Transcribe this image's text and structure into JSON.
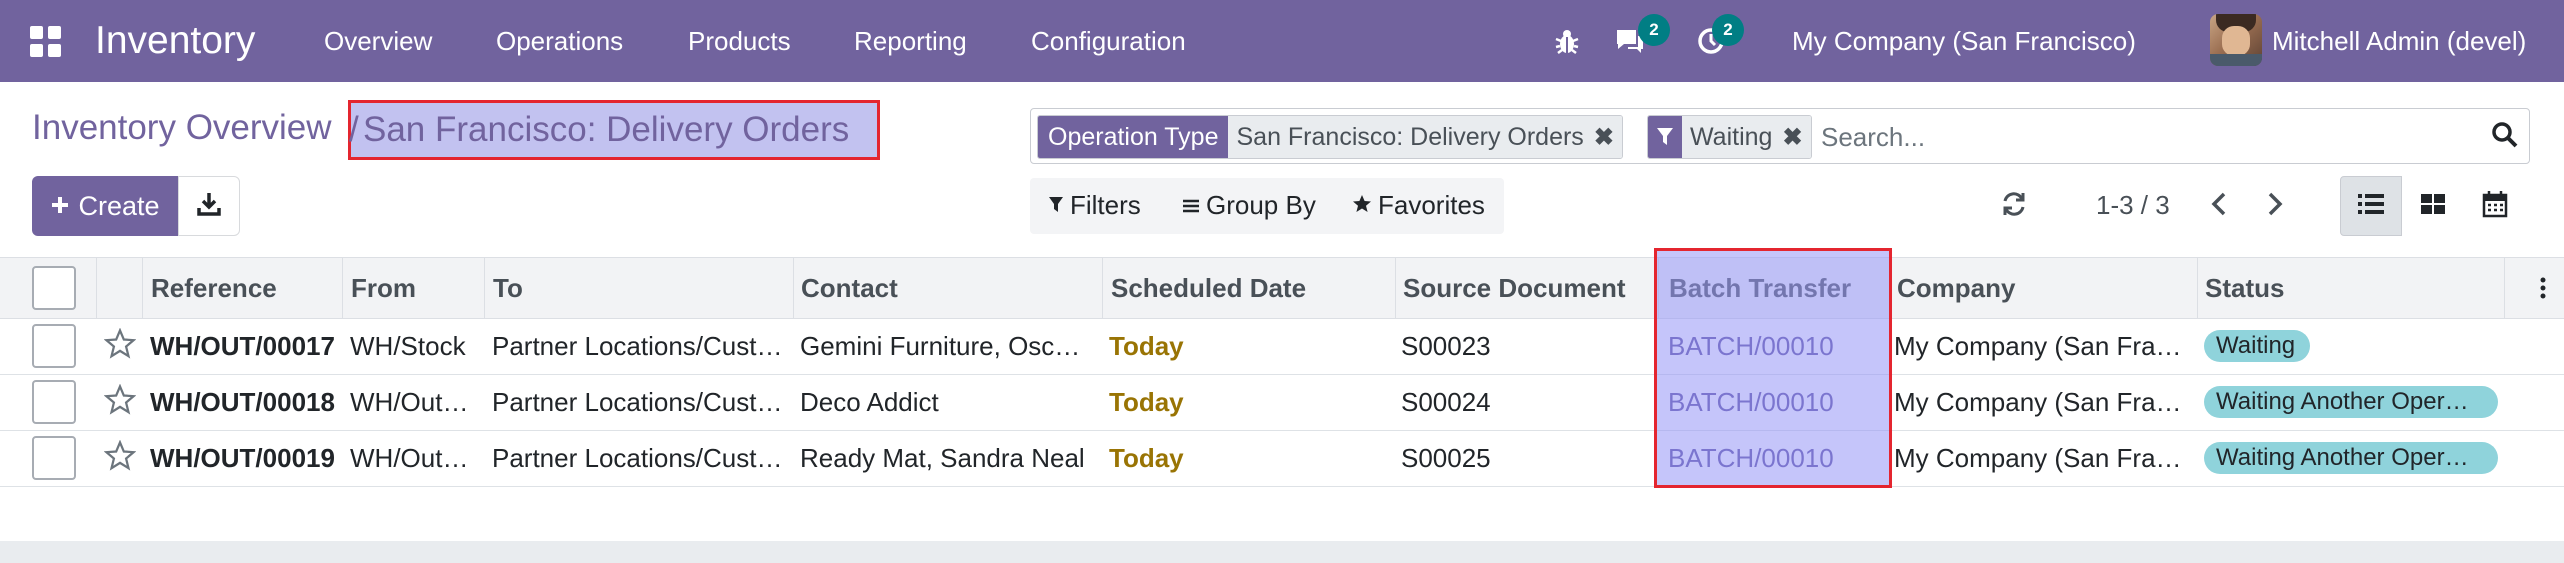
{
  "navbar": {
    "app_name": "Inventory",
    "menu": [
      "Overview",
      "Operations",
      "Products",
      "Reporting",
      "Configuration"
    ],
    "messages_count": "2",
    "activities_count": "2",
    "company": "My Company (San Francisco)",
    "user": "Mitchell Admin (devel)",
    "icons": [
      "apps-grid-icon",
      "bug-icon",
      "chat-icon",
      "clock-icon"
    ],
    "color": "#71639e"
  },
  "breadcrumb": {
    "parent": "Inventory Overview",
    "separator": "/",
    "current": "San Francisco: Delivery Orders"
  },
  "actions": {
    "create_label": "Create",
    "download_icon": "download-icon"
  },
  "search": {
    "facets": [
      {
        "label": "Operation Type",
        "value": "San Francisco: Delivery Orders"
      },
      {
        "label": "filter-icon",
        "value": "Waiting"
      }
    ],
    "placeholder": "Search..."
  },
  "filter_bar": {
    "filters": "Filters",
    "group_by": "Group By",
    "favorites": "Favorites"
  },
  "pager": {
    "value": "1-3 / 3"
  },
  "table": {
    "columns": [
      "Reference",
      "From",
      "To",
      "Contact",
      "Scheduled Date",
      "Source Document",
      "Batch Transfer",
      "Company",
      "Status"
    ],
    "rows": [
      {
        "reference": "WH/OUT/00017",
        "from": "WH/Stock",
        "to": "Partner Locations/Cust…",
        "contact": "Gemini Furniture, Osc…",
        "scheduled": "Today",
        "source": "S00023",
        "batch": "BATCH/00010",
        "company": "My Company (San Fra…",
        "status": "Waiting"
      },
      {
        "reference": "WH/OUT/00018",
        "from": "WH/Out…",
        "to": "Partner Locations/Cust…",
        "contact": "Deco Addict",
        "scheduled": "Today",
        "source": "S00024",
        "batch": "BATCH/00010",
        "company": "My Company (San Fra…",
        "status": "Waiting Another Oper…"
      },
      {
        "reference": "WH/OUT/00019",
        "from": "WH/Out…",
        "to": "Partner Locations/Cust…",
        "contact": "Ready Mat, Sandra Neal",
        "scheduled": "Today",
        "source": "S00025",
        "batch": "BATCH/00010",
        "company": "My Company (San Fra…",
        "status": "Waiting Another Oper…"
      }
    ]
  },
  "colors": {
    "today": "#997404",
    "status_badge": "#8fd3db",
    "highlight_border": "#e4252f"
  }
}
